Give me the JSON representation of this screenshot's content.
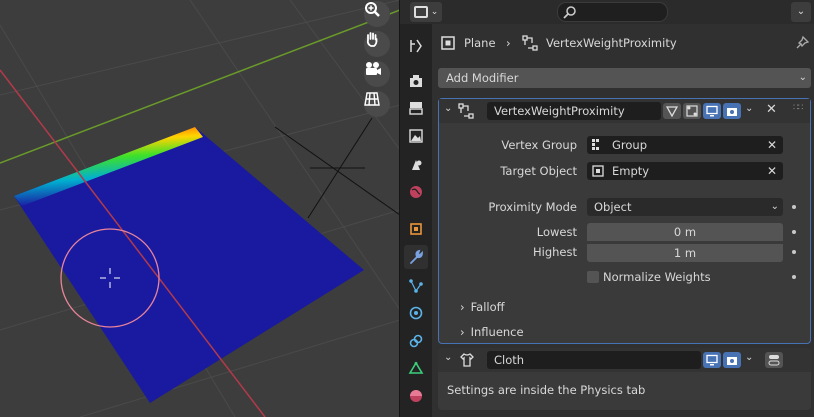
{
  "viewport": {
    "nav_icons": [
      "zoom-icon",
      "hand-icon",
      "camera-icon",
      "grid-icon"
    ]
  },
  "header": {
    "breadcrumb_object": "Plane",
    "breadcrumb_modifier": "VertexWeightProximity"
  },
  "add_modifier_label": "Add Modifier",
  "modifier1": {
    "name": "VertexWeightProximity",
    "vertex_group_label": "Vertex Group",
    "vertex_group_value": "Group",
    "target_object_label": "Target Object",
    "target_object_value": "Empty",
    "proximity_mode_label": "Proximity Mode",
    "proximity_mode_value": "Object",
    "lowest_label": "Lowest",
    "lowest_value": "0 m",
    "highest_label": "Highest",
    "highest_value": "1 m",
    "normalize_label": "Normalize Weights",
    "falloff_label": "Falloff",
    "influence_label": "Influence"
  },
  "modifier2": {
    "name": "Cloth",
    "info": "Settings are inside the Physics tab"
  },
  "colors": {
    "accent": "#4772b3",
    "plane": "#1a1aa0",
    "x_axis": "#b23a4a",
    "y_axis": "#6a9a2a",
    "brush": "#e9849a"
  }
}
